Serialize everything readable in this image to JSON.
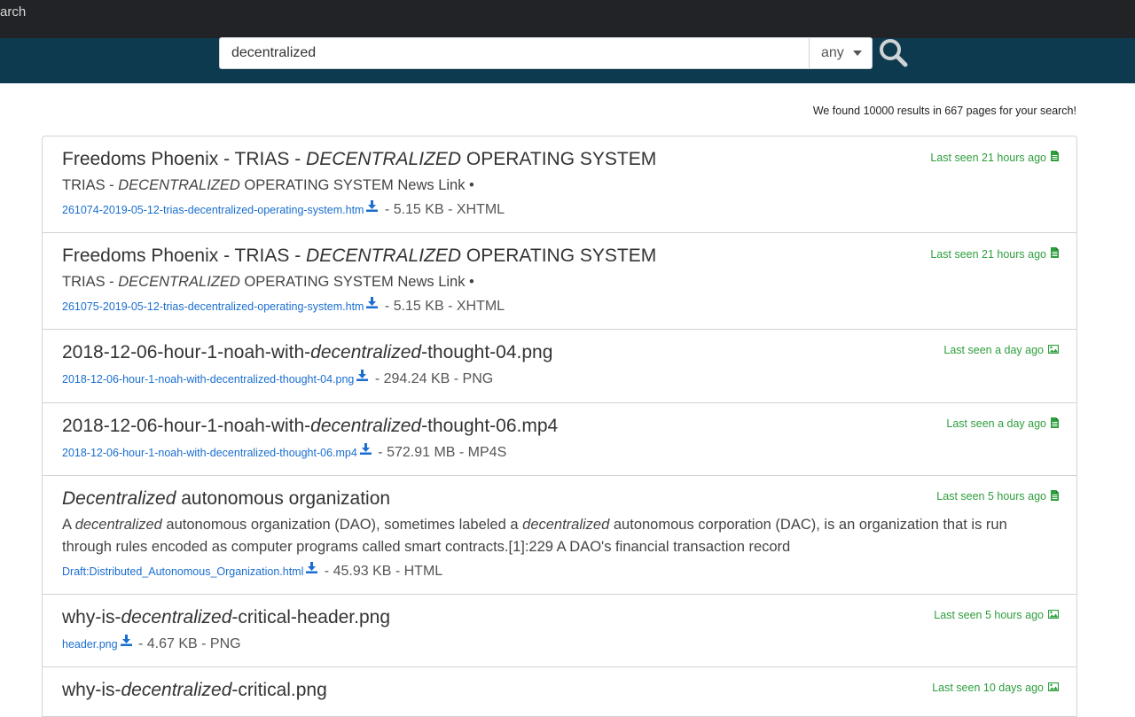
{
  "header": {
    "brand_text": "arch"
  },
  "search": {
    "query": "decentralized",
    "filter_selected": "any"
  },
  "summary": {
    "text": "We found 10000 results in 667 pages for your search!"
  },
  "results": [
    {
      "title_pre": "Freedoms Phoenix - TRIAS - ",
      "title_em": "DECENTRALIZED",
      "title_post": " OPERATING SYSTEM",
      "snippet_pre": "TRIAS - ",
      "snippet_em": "DECENTRALIZED",
      "snippet_post": " OPERATING SYSTEM News Link •",
      "file": "261074-2019-05-12-trias-decentralized-operating-system.htm",
      "meta": " - 5.15 KB - XHTML",
      "last_seen": "Last seen 21 hours ago",
      "type_icon": "file-icon"
    },
    {
      "title_pre": "Freedoms Phoenix - TRIAS - ",
      "title_em": "DECENTRALIZED",
      "title_post": " OPERATING SYSTEM",
      "snippet_pre": "TRIAS - ",
      "snippet_em": "DECENTRALIZED",
      "snippet_post": " OPERATING SYSTEM News Link •",
      "file": "261075-2019-05-12-trias-decentralized-operating-system.htm",
      "meta": " - 5.15 KB - XHTML",
      "last_seen": "Last seen 21 hours ago",
      "type_icon": "file-icon"
    },
    {
      "title_pre": "2018-12-06-hour-1-noah-with-",
      "title_em": "decentralized",
      "title_post": "-thought-04.png",
      "file": "2018-12-06-hour-1-noah-with-decentralized-thought-04.png",
      "meta": " - 294.24 KB - PNG",
      "last_seen": "Last seen a day ago",
      "type_icon": "image-icon"
    },
    {
      "title_pre": "2018-12-06-hour-1-noah-with-",
      "title_em": "decentralized",
      "title_post": "-thought-06.mp4",
      "file": "2018-12-06-hour-1-noah-with-decentralized-thought-06.mp4",
      "meta": " - 572.91 MB - MP4S",
      "last_seen": "Last seen a day ago",
      "type_icon": "file-icon"
    },
    {
      "title_pre": "",
      "title_em": "Decentralized",
      "title_post": " autonomous organization",
      "snippet_pre": "A ",
      "snippet_em": "decentralized",
      "snippet_mid": " autonomous organization (DAO), sometimes labeled a ",
      "snippet_em2": "decentralized",
      "snippet_post": " autonomous corporation (DAC), is an organization that is run through rules encoded as computer programs called smart contracts.[1]:229 A DAO's financial transaction record",
      "file": "Draft:Distributed_Autonomous_Organization.html",
      "meta": " - 45.93 KB - HTML",
      "last_seen": "Last seen 5 hours ago",
      "type_icon": "file-icon"
    },
    {
      "title_pre": "why-is-",
      "title_em": "decentralized",
      "title_post": "-critical-header.png",
      "file": "header.png",
      "meta": " - 4.67 KB - PNG",
      "last_seen": "Last seen 5 hours ago",
      "type_icon": "image-icon"
    },
    {
      "title_pre": "why-is-",
      "title_em": "decentralized",
      "title_post": "-critical.png",
      "last_seen": "Last seen 10 days ago",
      "type_icon": "image-icon"
    }
  ],
  "colors": {
    "topbar": "#212327",
    "search_band": "#0e3a4f",
    "link": "#1a6ecf",
    "last_seen": "#2e9e3d"
  }
}
